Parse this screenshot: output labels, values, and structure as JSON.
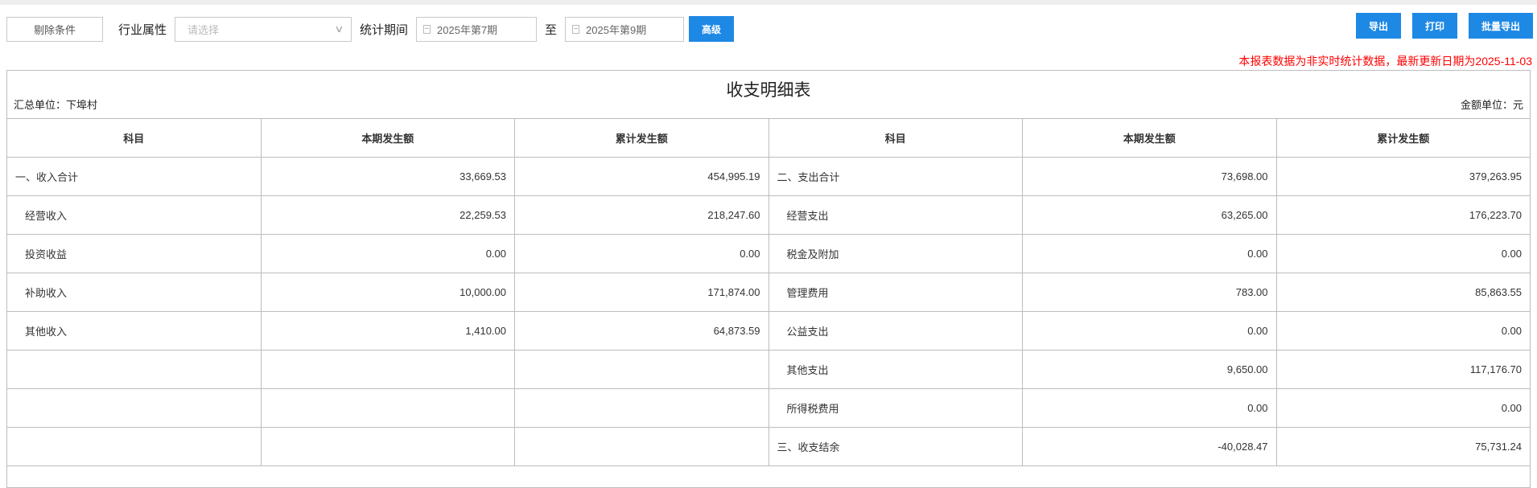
{
  "toolbar": {
    "clear_label": "剔除条件",
    "industry_label": "行业属性",
    "industry_placeholder": "请选择",
    "period_label": "统计期间",
    "period_from": "2025年第7期",
    "period_sep": "至",
    "period_to": "2025年第9期",
    "advanced_label": "高级"
  },
  "actions": {
    "export": "导出",
    "print": "打印",
    "batch_export": "批量导出"
  },
  "notice": "本报表数据为非实时统计数据，最新更新日期为2025-11-03",
  "report": {
    "title": "收支明细表",
    "unit_left": "汇总单位：下埠村",
    "unit_right": "金额单位：元",
    "headers": [
      "科目",
      "本期发生额",
      "累计发生额",
      "科目",
      "本期发生额",
      "累计发生额"
    ],
    "rows": [
      [
        "一、收入合计",
        "33,669.53",
        "454,995.19",
        "二、支出合计",
        "73,698.00",
        "379,263.95"
      ],
      [
        "经营收入",
        "22,259.53",
        "218,247.60",
        "经营支出",
        "63,265.00",
        "176,223.70"
      ],
      [
        "投资收益",
        "0.00",
        "0.00",
        "税金及附加",
        "0.00",
        "0.00"
      ],
      [
        "补助收入",
        "10,000.00",
        "171,874.00",
        "管理费用",
        "783.00",
        "85,863.55"
      ],
      [
        "其他收入",
        "1,410.00",
        "64,873.59",
        "公益支出",
        "0.00",
        "0.00"
      ],
      [
        "",
        "",
        "",
        "其他支出",
        "9,650.00",
        "117,176.70"
      ],
      [
        "",
        "",
        "",
        "所得税费用",
        "0.00",
        "0.00"
      ],
      [
        "",
        "",
        "",
        "三、收支结余",
        "-40,028.47",
        "75,731.24"
      ]
    ]
  }
}
